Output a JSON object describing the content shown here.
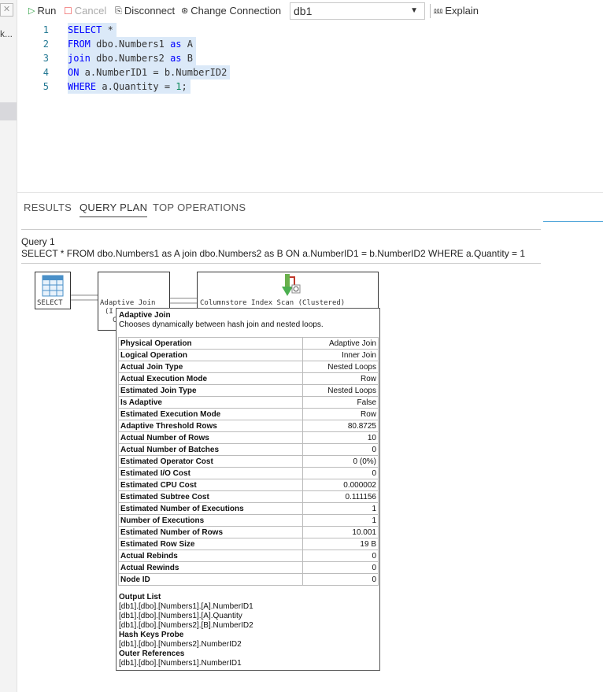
{
  "toolbar": {
    "run_label": "Run",
    "cancel_label": "Cancel",
    "disconnect_label": "Disconnect",
    "change_connection_label": "Change Connection",
    "database_value": "db1",
    "explain_label": "Explain"
  },
  "sidebar": {
    "truncated_text": "k..."
  },
  "editor": {
    "line_numbers": [
      "1",
      "2",
      "3",
      "4",
      "5"
    ]
  },
  "panel": {
    "tabs": [
      "RESULTS",
      "QUERY PLAN",
      "TOP OPERATIONS"
    ],
    "active_tab": "QUERY PLAN",
    "query_title": "Query 1",
    "query_statement": "SELECT * FROM dbo.Numbers1 as A join dbo.Numbers2 as B ON a.NumberID1 = b.NumberID2 WHERE a.Quantity = 1"
  },
  "plan_nodes": {
    "select_label": "SELECT",
    "join_label": "Adaptive Join",
    "join_sub_label": "(I",
    "join_sub_label2": "C",
    "scan_label": "Columnstore Index Scan (Clustered)"
  },
  "tooltip": {
    "title": "Adaptive Join",
    "description": "Chooses dynamically between hash join and nested loops.",
    "properties": [
      {
        "name": "Physical Operation",
        "value": "Adaptive Join"
      },
      {
        "name": "Logical Operation",
        "value": "Inner Join"
      },
      {
        "name": "Actual Join Type",
        "value": "Nested Loops"
      },
      {
        "name": "Actual Execution Mode",
        "value": "Row"
      },
      {
        "name": "Estimated Join Type",
        "value": "Nested Loops"
      },
      {
        "name": "Is Adaptive",
        "value": "False"
      },
      {
        "name": "Estimated Execution Mode",
        "value": "Row"
      },
      {
        "name": "Adaptive Threshold Rows",
        "value": "80.8725"
      },
      {
        "name": "Actual Number of Rows",
        "value": "10"
      },
      {
        "name": "Actual Number of Batches",
        "value": "0"
      },
      {
        "name": "Estimated Operator Cost",
        "value": "0 (0%)"
      },
      {
        "name": "Estimated I/O Cost",
        "value": "0"
      },
      {
        "name": "Estimated CPU Cost",
        "value": "0.000002"
      },
      {
        "name": "Estimated Subtree Cost",
        "value": "0.111156"
      },
      {
        "name": "Estimated Number of Executions",
        "value": "1"
      },
      {
        "name": "Number of Executions",
        "value": "1"
      },
      {
        "name": "Estimated Number of Rows",
        "value": "10.001"
      },
      {
        "name": "Estimated Row Size",
        "value": "19 B"
      },
      {
        "name": "Actual Rebinds",
        "value": "0"
      },
      {
        "name": "Actual Rewinds",
        "value": "0"
      },
      {
        "name": "Node ID",
        "value": "0"
      }
    ],
    "output_list_header": "Output List",
    "output_list": [
      "[db1].[dbo].[Numbers1].[A].NumberID1",
      "[db1].[dbo].[Numbers1].[A].Quantity",
      "[db1].[dbo].[Numbers2].[B].NumberID2"
    ],
    "hash_keys_header": "Hash Keys Probe",
    "hash_keys": [
      "[db1].[dbo].[Numbers2].NumberID2"
    ],
    "outer_refs_header": "Outer References",
    "outer_refs": [
      "[db1].[dbo].[Numbers1].NumberID1"
    ]
  },
  "colors": {
    "accent": "#4aa3d8",
    "selection": "#dbe9f8",
    "keyword": "#0000ff",
    "number": "#09885a",
    "run_icon": "#2ea043"
  }
}
